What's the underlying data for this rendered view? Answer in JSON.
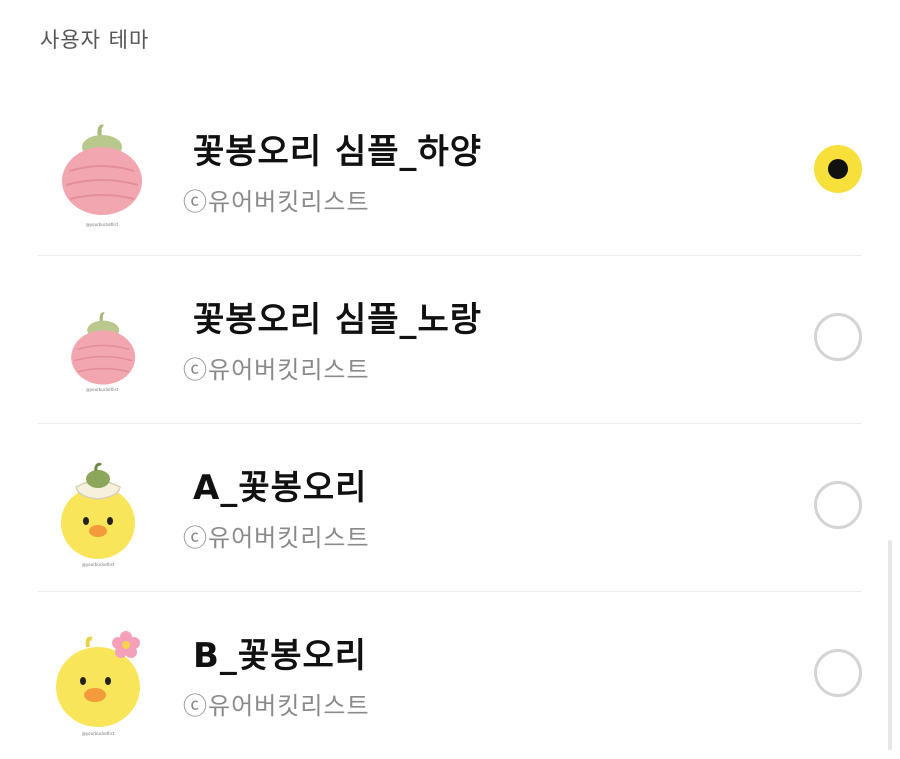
{
  "section": {
    "title": "사용자 테마"
  },
  "themes": [
    {
      "name": "꽃봉오리 심플_하양",
      "author": "ⓒ유어버킷리스트",
      "selected": true,
      "thumb_icon": "pink-flower-bud-icon"
    },
    {
      "name": "꽃봉오리 심플_노랑",
      "author": "ⓒ유어버킷리스트",
      "selected": false,
      "thumb_icon": "pink-flower-bud-icon"
    },
    {
      "name": "A_꽃봉오리",
      "author": "ⓒ유어버킷리스트",
      "selected": false,
      "thumb_icon": "chick-bud-hat-icon"
    },
    {
      "name": "B_꽃봉오리",
      "author": "ⓒ유어버킷리스트",
      "selected": false,
      "thumb_icon": "chick-flower-icon"
    }
  ],
  "colors": {
    "accent": "#f7e03a",
    "radio_border": "#d4d4d4",
    "bud_pink": "#f2a7b0",
    "bud_green": "#b9c98e",
    "chick_yellow": "#f8e55a"
  }
}
